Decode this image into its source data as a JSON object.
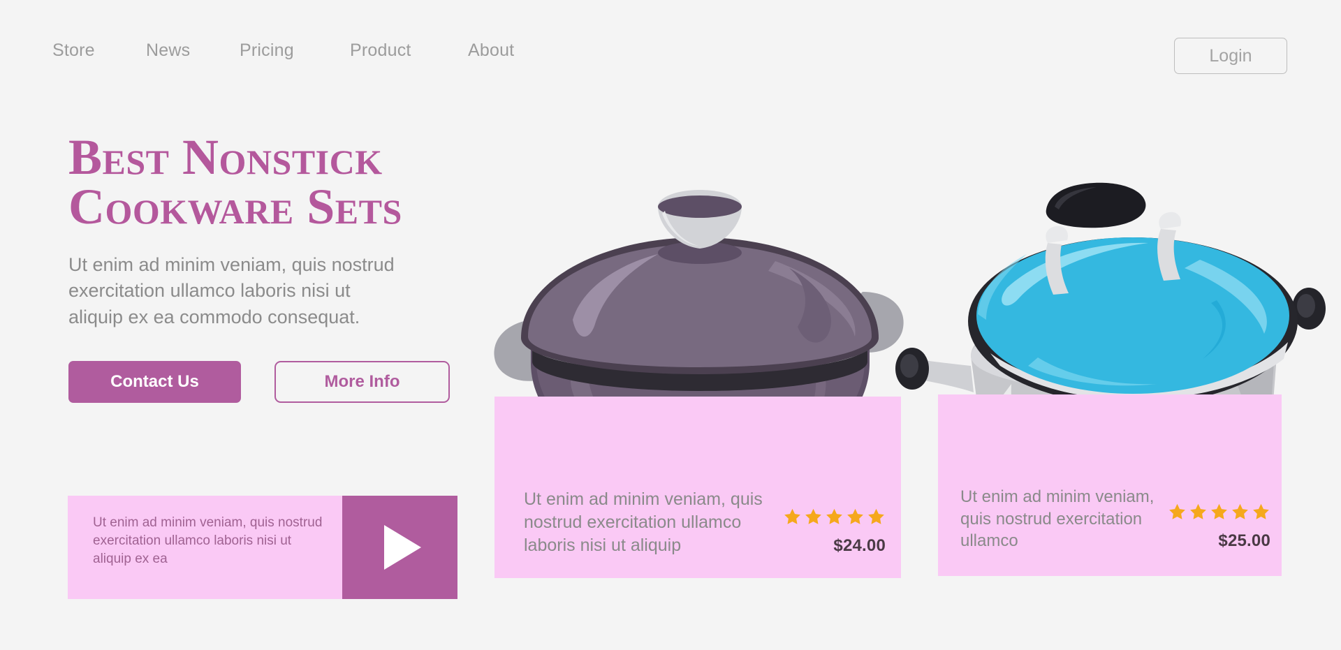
{
  "brand": {
    "accent": "#b05c9e",
    "headline_color": "#b4589c",
    "card_pink": "#fac9f5",
    "background": "#f4f4f4",
    "star_color": "#f5a81c",
    "muted_text": "#8b8b8b"
  },
  "nav": {
    "items": [
      {
        "label": "Store"
      },
      {
        "label": "News"
      },
      {
        "label": "Pricing"
      },
      {
        "label": "Product"
      },
      {
        "label": "About"
      }
    ],
    "login_label": "Login"
  },
  "hero": {
    "headline_line1": "Best Nonstick",
    "headline_line2": "Cookware Sets",
    "subtext": "Ut enim ad minim veniam, quis nostrud exercitation ullamco laboris nisi ut aliquip ex ea commodo consequat.",
    "primary_cta": "Contact Us",
    "secondary_cta": "More Info"
  },
  "video_card": {
    "text": "Ut enim ad minim veniam, quis nostrud exercitation ullamco laboris nisi ut aliquip ex ea",
    "play_icon": "play-icon"
  },
  "products": [
    {
      "description": "Ut enim ad minim veniam, quis nostrud exercitation ullamco laboris nisi ut aliquip",
      "price": "$24.00",
      "rating": 5,
      "image": "purple-casserole-pot"
    },
    {
      "description": "Ut enim ad minim veniam, quis nostrud exercitation ullamco",
      "price": "$25.00",
      "rating": 5,
      "image": "steel-pot-blue-lid"
    }
  ]
}
